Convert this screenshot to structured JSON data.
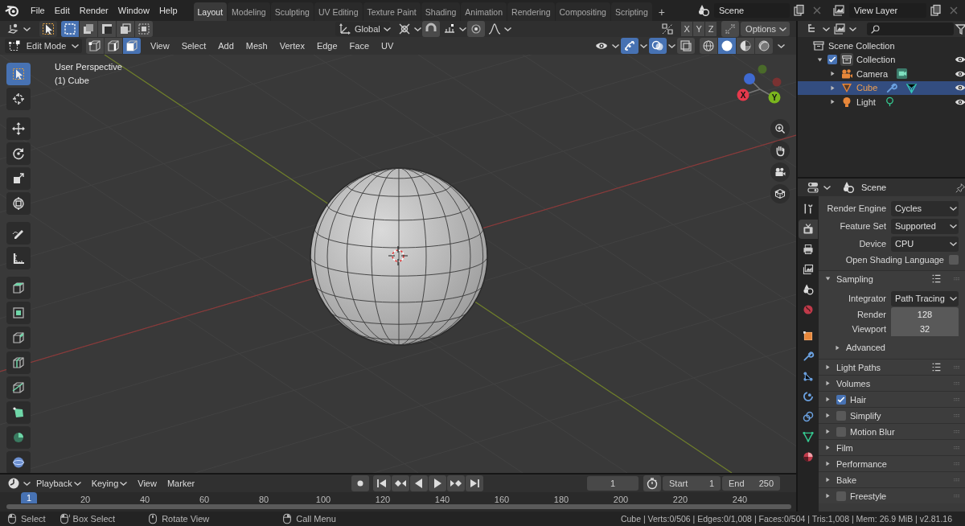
{
  "menu": [
    "File",
    "Edit",
    "Render",
    "Window",
    "Help"
  ],
  "workspaces": [
    {
      "label": "Layout",
      "selected": true
    },
    {
      "label": "Modeling",
      "selected": false
    },
    {
      "label": "Sculpting",
      "selected": false
    },
    {
      "label": "UV Editing",
      "selected": false
    },
    {
      "label": "Texture Paint",
      "selected": false
    },
    {
      "label": "Shading",
      "selected": false
    },
    {
      "label": "Animation",
      "selected": false
    },
    {
      "label": "Rendering",
      "selected": false
    },
    {
      "label": "Compositing",
      "selected": false
    },
    {
      "label": "Scripting",
      "selected": false
    }
  ],
  "add_workspace": "+",
  "scene": "Scene",
  "view_layer": "View Layer",
  "tool_header": {
    "select_box_modes": [
      {
        "selected": true
      },
      {
        "selected": false
      },
      {
        "selected": false
      },
      {
        "selected": false
      },
      {
        "selected": false
      }
    ],
    "orientation": "Global",
    "mirror_axes": [
      "X",
      "Y",
      "Z"
    ],
    "options": "Options"
  },
  "viewport_header": {
    "mode": "Edit Mode",
    "select_modes": [
      {
        "selected": false
      },
      {
        "selected": false
      },
      {
        "selected": true
      }
    ],
    "menus": [
      "View",
      "Select",
      "Add",
      "Mesh",
      "Vertex",
      "Edge",
      "Face",
      "UV"
    ],
    "gizmos_on": true,
    "overlays_on": true,
    "xray_on": false,
    "shading": [
      {
        "selected": false
      },
      {
        "selected": true
      },
      {
        "selected": false
      },
      {
        "selected": false
      }
    ]
  },
  "viewport": {
    "view_name": "User Perspective",
    "object_name": "(1) Cube",
    "gizmo_labels": [
      "X",
      "Y"
    ]
  },
  "toolbar": [
    {
      "selected": true
    },
    {
      "selected": false
    },
    {
      "selected": false
    },
    {
      "selected": false
    },
    {
      "selected": false
    },
    {
      "selected": false
    },
    {
      "selected": false
    },
    {
      "selected": false
    },
    {
      "selected": false
    },
    {
      "selected": false
    },
    {
      "selected": false
    },
    {
      "selected": false
    },
    {
      "selected": false
    },
    {
      "selected": false
    },
    {
      "selected": false
    },
    {
      "selected": false
    }
  ],
  "outliner": {
    "root": "Scene Collection",
    "collections": [
      {
        "label": "Collection",
        "checked": true,
        "expanded": true,
        "children": [
          {
            "label": "Camera",
            "kind": "camera",
            "selected": false,
            "expanded": false
          },
          {
            "label": "Cube",
            "kind": "mesh",
            "selected": true,
            "expanded": false
          },
          {
            "label": "Light",
            "kind": "light",
            "selected": false,
            "expanded": false
          }
        ]
      }
    ]
  },
  "properties": {
    "context": "Scene",
    "tabs": [
      {
        "selected": false
      },
      {
        "selected": true
      },
      {
        "selected": false
      },
      {
        "selected": false
      },
      {
        "selected": false
      },
      {
        "selected": false
      },
      {
        "selected": false
      },
      {
        "selected": false
      },
      {
        "selected": false
      },
      {
        "selected": false
      },
      {
        "selected": false
      },
      {
        "selected": false
      },
      {
        "selected": false
      }
    ],
    "fields": [
      {
        "kind": "dropdown",
        "label": "Render Engine",
        "value": "Cycles"
      },
      {
        "kind": "dropdown",
        "label": "Feature Set",
        "value": "Supported"
      },
      {
        "kind": "dropdown",
        "label": "Device",
        "value": "CPU"
      },
      {
        "kind": "checkbox",
        "label": "Open Shading Language",
        "checked": false
      }
    ],
    "panels": [
      {
        "title": "Sampling",
        "kind": "plain",
        "expanded": true,
        "presets": true,
        "fields": [
          {
            "kind": "dropdown",
            "label": "Integrator",
            "value": "Path Tracing"
          },
          {
            "kind": "number",
            "label": "Render",
            "value": "128"
          },
          {
            "kind": "number",
            "label": "Viewport",
            "value": "32"
          }
        ],
        "subpanels": [
          {
            "title": "Advanced",
            "expanded": false
          }
        ]
      },
      {
        "title": "Light Paths",
        "kind": "plain",
        "expanded": false,
        "presets": true
      },
      {
        "title": "Volumes",
        "kind": "plain",
        "expanded": false,
        "presets": false
      },
      {
        "title": "Hair",
        "kind": "check",
        "checked": true,
        "expanded": false,
        "presets": false
      },
      {
        "title": "Simplify",
        "kind": "check",
        "checked": false,
        "expanded": false,
        "presets": false
      },
      {
        "title": "Motion Blur",
        "kind": "check",
        "checked": false,
        "expanded": false,
        "presets": false
      },
      {
        "title": "Film",
        "kind": "plain",
        "expanded": false,
        "presets": false
      },
      {
        "title": "Performance",
        "kind": "plain",
        "expanded": false,
        "presets": false
      },
      {
        "title": "Bake",
        "kind": "plain",
        "expanded": false,
        "presets": false
      },
      {
        "title": "Freestyle",
        "kind": "check",
        "checked": false,
        "expanded": false,
        "presets": false
      }
    ]
  },
  "timeline": {
    "menus": [
      {
        "label": "Playback",
        "dropdown": true
      },
      {
        "label": "Keying",
        "dropdown": true
      },
      {
        "label": "View",
        "dropdown": false
      },
      {
        "label": "Marker",
        "dropdown": false
      }
    ],
    "current_frame": "1",
    "start_label": "Start",
    "start": "1",
    "end_label": "End",
    "end": "250",
    "playhead": "1",
    "ruler": [
      "20",
      "40",
      "60",
      "80",
      "100",
      "120",
      "140",
      "160",
      "180",
      "200",
      "220",
      "240"
    ]
  },
  "status_bar": {
    "hints": [
      {
        "label": "Select"
      },
      {
        "label": "Box Select"
      },
      {
        "label": "Rotate View"
      },
      {
        "label": "Call Menu"
      }
    ],
    "stats": "Cube | Verts:0/506 | Edges:0/1,008 | Faces:0/504 | Tris:1,008 | Mem: 26.9 MiB | v2.81.16"
  }
}
